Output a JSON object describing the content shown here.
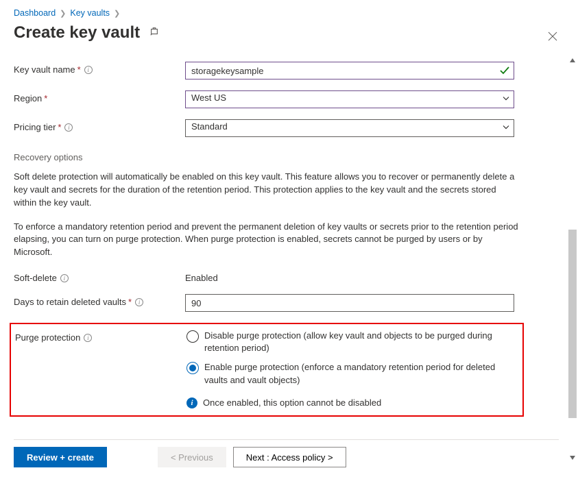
{
  "breadcrumbs": {
    "dashboard": "Dashboard",
    "keyvaults": "Key vaults"
  },
  "header": {
    "title": "Create key vault"
  },
  "labels": {
    "kv_name": "Key vault name",
    "region": "Region",
    "pricing_tier": "Pricing tier",
    "soft_delete": "Soft-delete",
    "days_retain": "Days to retain deleted vaults",
    "purge_protection": "Purge protection"
  },
  "values": {
    "kv_name": "storagekeysample",
    "region": "West US",
    "pricing_tier": "Standard",
    "soft_delete": "Enabled",
    "days_retain": "90"
  },
  "section": {
    "recovery_heading": "Recovery options",
    "para1": "Soft delete protection will automatically be enabled on this key vault. This feature allows you to recover or permanently delete a key vault and secrets for the duration of the retention period. This protection applies to the key vault and the secrets stored within the key vault.",
    "para2": "To enforce a mandatory retention period and prevent the permanent deletion of key vaults or secrets prior to the retention period elapsing, you can turn on purge protection. When purge protection is enabled, secrets cannot be purged by users or by Microsoft."
  },
  "purge": {
    "disable": "Disable purge protection (allow key vault and objects to be purged during retention period)",
    "enable": "Enable purge protection (enforce a mandatory retention period for deleted vaults and vault objects)",
    "note": "Once enabled, this option cannot be disabled",
    "selected": "enable"
  },
  "footer": {
    "review": "Review + create",
    "previous": "< Previous",
    "next": "Next : Access policy >"
  }
}
